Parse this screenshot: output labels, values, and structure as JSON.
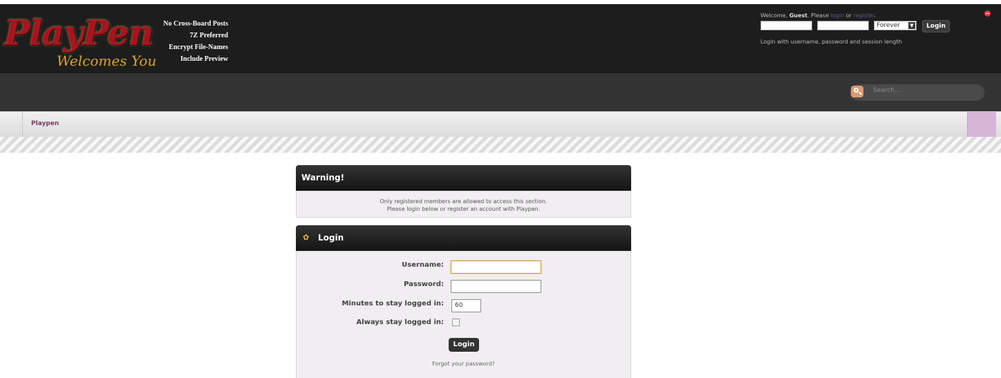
{
  "header": {
    "logo": {
      "main": "PlayPen",
      "sub": "Welcomes You"
    },
    "rules": [
      "No Cross-Board Posts",
      "7Z Preferred",
      "Encrypt File-Names",
      "Include Preview"
    ]
  },
  "userbox": {
    "welcome_prefix": "Welcome, ",
    "guest": "Guest",
    "please": ". Please ",
    "login_link": "login",
    "or": " or ",
    "register_link": "register",
    "end": ".",
    "session_option": "Forever",
    "login_button": "Login",
    "help": "Login with username, password and session length"
  },
  "search": {
    "placeholder": "Search..."
  },
  "breadcrumb": {
    "item": "Playpen"
  },
  "warning": {
    "title": "Warning!",
    "line1": "Only registered members are allowed to access this section.",
    "line2": "Please login below or register an account with Playpen."
  },
  "login": {
    "title": "Login",
    "username_label": "Username:",
    "username_value": "",
    "password_label": "Password:",
    "minutes_label": "Minutes to stay logged in:",
    "minutes_value": "60",
    "always_label": "Always stay logged in:",
    "submit": "Login",
    "forgot": "Forgot your password?"
  },
  "colors": {
    "accent": "#7a3a6a",
    "header_bg": "#1d1d1d",
    "toolbar_bg": "#333333"
  }
}
